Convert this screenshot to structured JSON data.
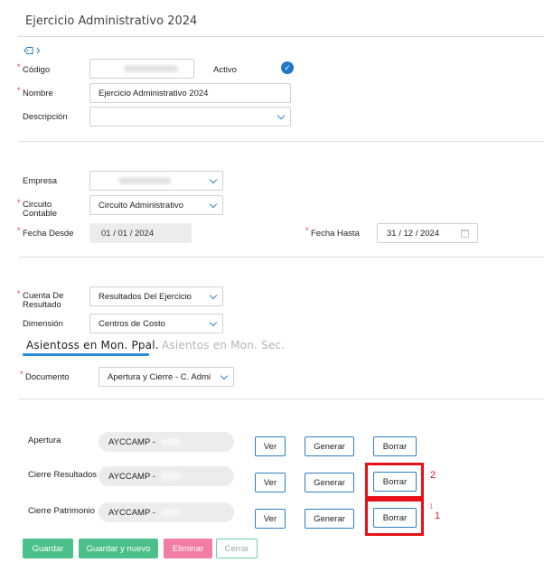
{
  "header": {
    "title": "Ejercicio Administrativo 2024"
  },
  "general": {
    "codigo_label": "Código",
    "activo_label": "Activo",
    "activo_icon": "check-icon",
    "nombre_label": "Nombre",
    "nombre_value": "Ejercicio Administrativo 2024",
    "descripcion_label": "Descripción",
    "descripcion_value": ""
  },
  "empresa": {
    "empresa_label": "Empresa",
    "circuito_label_1": "Circuito",
    "circuito_label_2": "Contable",
    "circuito_value": "Circuito Administrativo",
    "fecha_desde_label": "Fecha Desde",
    "fecha_desde_value": "01 / 01 / 2024",
    "fecha_hasta_label": "Fecha Hasta",
    "fecha_hasta_value": "31 / 12 / 2024"
  },
  "resultado": {
    "cuenta_label_1": "Cuenta De",
    "cuenta_label_2": "Resultado",
    "cuenta_value": "Resultados Del Ejercicio",
    "dimension_label": "Dimensión",
    "dimension_value": "Centros de Costo"
  },
  "tabs": [
    {
      "label": "Asientoss en Mon. Ppal.",
      "active": true
    },
    {
      "label": "Asientos en Mon. Sec.",
      "active": false
    }
  ],
  "documento": {
    "label": "Documento",
    "value": "Apertura y Cierre - C. Admi"
  },
  "asientos": [
    {
      "label": "Apertura",
      "value": "AYCCAMP -",
      "ver": "Ver",
      "generar": "Generar",
      "borrar": "Borrar"
    },
    {
      "label": "Cierre Resultados",
      "value": "AYCCAMP -",
      "ver": "Ver",
      "generar": "Generar",
      "borrar": "Borrar"
    },
    {
      "label": "Cierre Patrimonio",
      "value": "AYCCAMP -",
      "ver": "Ver",
      "generar": "Generar",
      "borrar": "Borrar"
    }
  ],
  "annotations": {
    "mark_2": "2",
    "mark_1_small": "1",
    "mark_1": "1",
    "color": "#e8111a"
  },
  "footer": {
    "guardar": "Guardar",
    "guardar_nuevo": "Guardar y nuevo",
    "eliminar": "Eliminar",
    "cerrar": "Cerrar"
  },
  "colors": {
    "accent": "#1f77c9",
    "guardar": "#4cc08a",
    "eliminar": "#f27da3",
    "cerrar_border": "#6bd3a8"
  }
}
